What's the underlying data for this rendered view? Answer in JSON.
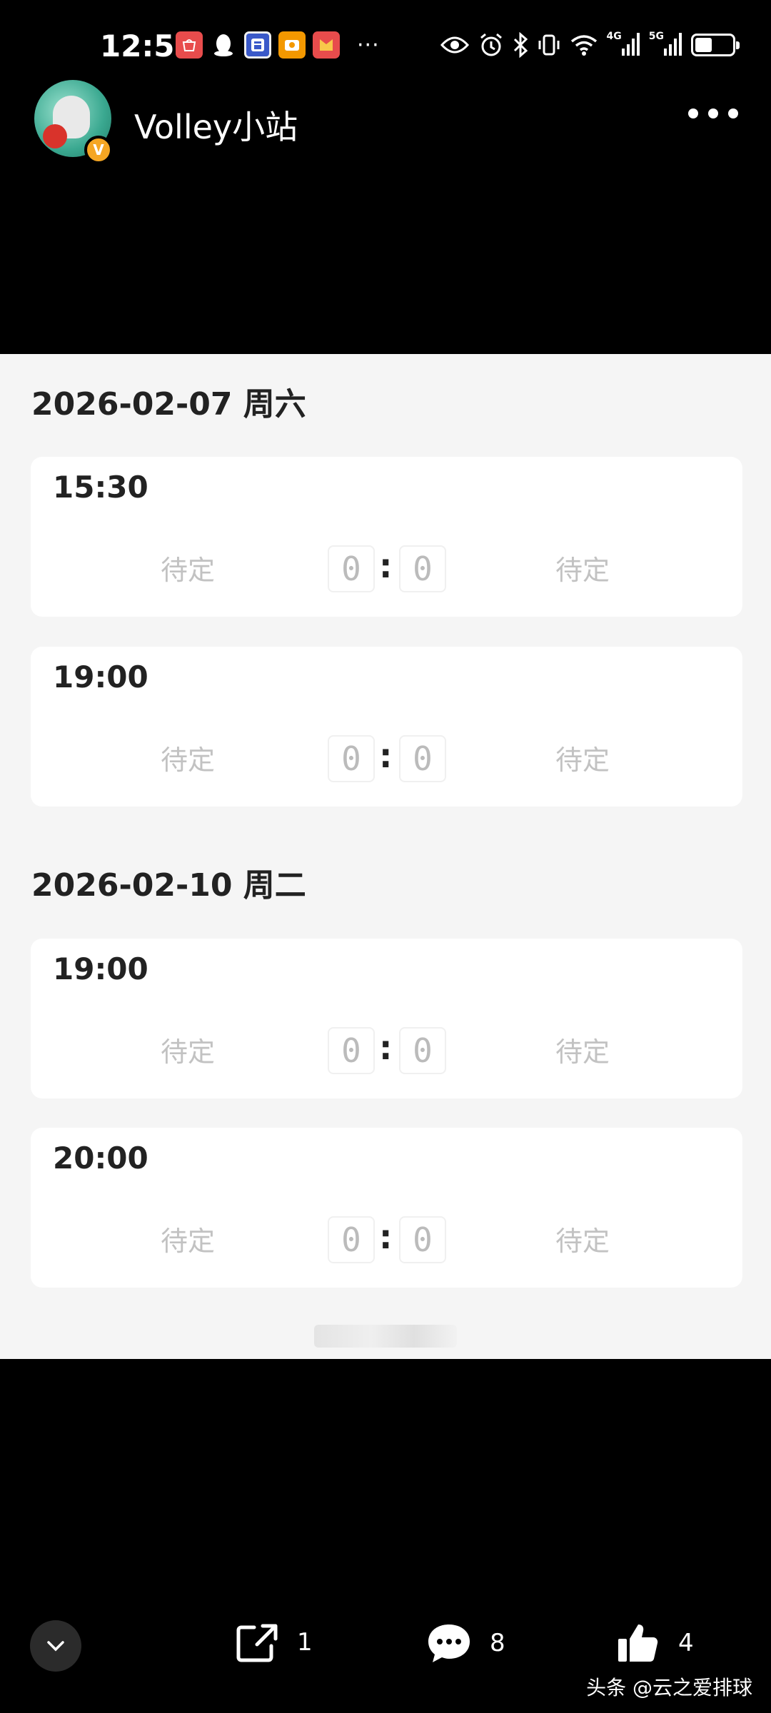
{
  "status_bar": {
    "time": "12:51",
    "notification_icons": [
      "huawei-appgallery-icon",
      "qq-icon",
      "tieba-icon",
      "wallet-icon",
      "red-packet-icon"
    ],
    "overflow": "···",
    "network_1": "4G",
    "network_2": "5G",
    "battery_level": 0.45
  },
  "header": {
    "account_name": "Volley小站",
    "verified_badge": "V"
  },
  "schedule": [
    {
      "date": "2026-02-07 周六",
      "matches": [
        {
          "time": "15:30",
          "home": "待定",
          "home_score": "0",
          "away_score": "0",
          "away": "待定"
        },
        {
          "time": "19:00",
          "home": "待定",
          "home_score": "0",
          "away_score": "0",
          "away": "待定"
        }
      ]
    },
    {
      "date": "2026-02-10 周二",
      "matches": [
        {
          "time": "19:00",
          "home": "待定",
          "home_score": "0",
          "away_score": "0",
          "away": "待定"
        },
        {
          "time": "20:00",
          "home": "待定",
          "home_score": "0",
          "away_score": "0",
          "away": "待定"
        }
      ]
    }
  ],
  "score_separator": ":",
  "actions": {
    "share_count": "1",
    "comment_count": "8",
    "like_count": "4"
  },
  "source_tag": "头条 @云之爱排球"
}
